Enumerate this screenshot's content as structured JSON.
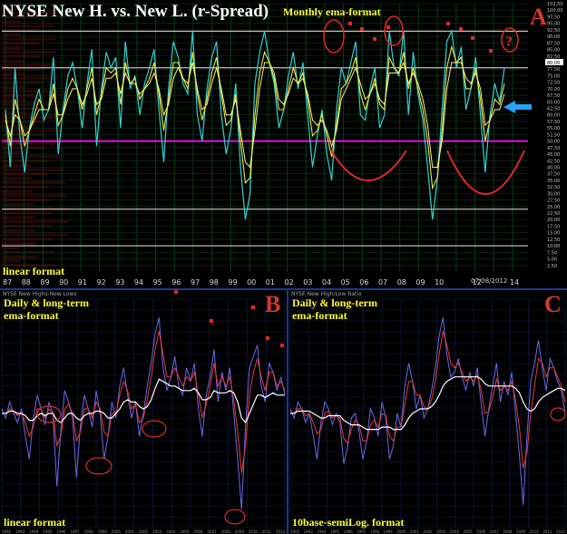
{
  "panel_a": {
    "title": "NYSE New H. vs. New L. (r-Spread)",
    "subtitle": "Monthly ema-format",
    "corner_label": "A",
    "bottom_note": "linear format",
    "date_marker": "07/08/2012",
    "question_mark": "?",
    "last_value_box": "80,00"
  },
  "panel_b": {
    "header_note": "NYSE New Highs-New Lows",
    "label": "Daily & long-term\nema-format",
    "corner_label": "B",
    "bottom_note": "linear format"
  },
  "panel_c": {
    "header_note": "NYSE New High/Low Ratio",
    "label": "Daily & long-term\nema-format",
    "corner_label": "C",
    "bottom_note": "10base-semiLog. format"
  },
  "chart_data": [
    {
      "type": "line",
      "title": "NYSE New H. vs. New L. (r-Spread)",
      "subtitle": "Monthly ema-format",
      "xlabel": "",
      "ylabel": "",
      "x_ticks": [
        "87",
        "88",
        "89",
        "90",
        "91",
        "92",
        "93",
        "94",
        "95",
        "96",
        "97",
        "98",
        "99",
        "00",
        "01",
        "02",
        "03",
        "04",
        "05",
        "06",
        "07",
        "08",
        "09",
        "10",
        "",
        "12",
        "",
        "14"
      ],
      "y_ticks": [
        "102,50",
        "100,00",
        "97,50",
        "95,00",
        "92,50",
        "90,00",
        "87,50",
        "85,00",
        "82,50",
        "80,00",
        "77,50",
        "75,00",
        "72,50",
        "70,00",
        "67,50",
        "65,00",
        "62,50",
        "60,00",
        "57,50",
        "55,00",
        "52,50",
        "50,00",
        "47,50",
        "45,00",
        "42,50",
        "40,00",
        "37,50",
        "35,00",
        "32,50",
        "30,00",
        "27,50",
        "25,00",
        "22,50",
        "20,00",
        "17,50",
        "15,00",
        "12,50",
        "10,00",
        "7,50",
        "5,00",
        "2,50"
      ],
      "ylim": [
        0,
        102.5
      ],
      "reference_lines": [
        92,
        78,
        50,
        24,
        10
      ],
      "highlight_line": 50,
      "series": [
        {
          "values": [
            62,
            40,
            78,
            52,
            38,
            55,
            64,
            70,
            58,
            62,
            82,
            45,
            62,
            75,
            80,
            70,
            55,
            72,
            85,
            48,
            70,
            84,
            78,
            82,
            55,
            88,
            70,
            75,
            60,
            72,
            78,
            85,
            62,
            42,
            70,
            88,
            82,
            72,
            68,
            92,
            60,
            50,
            70,
            82,
            88,
            60,
            45,
            55,
            72,
            40,
            20,
            30,
            72,
            84,
            92,
            80,
            72,
            55,
            62,
            75,
            84,
            70,
            80,
            60,
            40,
            52,
            62,
            45,
            35,
            62,
            78,
            72,
            80,
            88,
            60,
            58,
            70,
            78,
            55,
            60,
            92,
            78,
            75,
            92,
            60,
            84,
            68,
            58,
            40,
            20,
            35,
            62,
            88,
            92,
            78,
            86,
            62,
            70,
            82,
            60,
            38,
            60,
            72,
            65,
            78
          ]
        },
        {
          "values": [
            60,
            48,
            66,
            58,
            48,
            54,
            60,
            66,
            62,
            62,
            72,
            56,
            60,
            70,
            74,
            70,
            62,
            70,
            78,
            60,
            68,
            78,
            76,
            78,
            64,
            80,
            72,
            74,
            66,
            70,
            74,
            80,
            68,
            54,
            66,
            80,
            80,
            74,
            70,
            84,
            68,
            58,
            66,
            76,
            82,
            68,
            56,
            58,
            68,
            50,
            34,
            36,
            60,
            76,
            84,
            80,
            74,
            62,
            62,
            70,
            78,
            72,
            76,
            66,
            52,
            54,
            60,
            52,
            44,
            56,
            70,
            72,
            76,
            82,
            68,
            62,
            68,
            74,
            64,
            62,
            82,
            78,
            76,
            84,
            70,
            78,
            70,
            62,
            50,
            32,
            36,
            54,
            78,
            86,
            80,
            82,
            70,
            70,
            78,
            66,
            50,
            58,
            66,
            64,
            72
          ]
        },
        {
          "values": [
            58,
            52,
            60,
            58,
            52,
            54,
            58,
            62,
            62,
            62,
            68,
            60,
            60,
            66,
            70,
            70,
            64,
            68,
            74,
            64,
            66,
            74,
            74,
            76,
            68,
            76,
            72,
            72,
            68,
            70,
            72,
            76,
            70,
            60,
            64,
            74,
            78,
            74,
            72,
            80,
            70,
            62,
            64,
            72,
            78,
            70,
            60,
            60,
            66,
            54,
            42,
            40,
            54,
            70,
            80,
            80,
            76,
            66,
            64,
            68,
            74,
            72,
            74,
            68,
            58,
            56,
            58,
            54,
            48,
            54,
            66,
            70,
            74,
            78,
            72,
            66,
            68,
            72,
            66,
            64,
            76,
            76,
            76,
            80,
            72,
            76,
            72,
            66,
            56,
            40,
            40,
            50,
            70,
            80,
            80,
            80,
            74,
            72,
            76,
            70,
            56,
            58,
            62,
            62,
            68
          ]
        }
      ]
    },
    {
      "type": "line",
      "title": "Daily & long-term ema-format",
      "xlabel": "",
      "ylabel": "",
      "x_ticks": [
        "1992",
        "1993",
        "1994",
        "1995",
        "1996",
        "1997",
        "1998",
        "1999",
        "2000",
        "2001",
        "2002",
        "2003",
        "2004",
        "2005",
        "2006",
        "2007",
        "2008",
        "2009",
        "2010",
        "2011",
        "2012"
      ],
      "series": [
        {
          "values": [
            52,
            48,
            55,
            50,
            46,
            52,
            40,
            30,
            48,
            58,
            52,
            45,
            55,
            50,
            18,
            42,
            60,
            55,
            48,
            22,
            45,
            58,
            52,
            44,
            60,
            50,
            30,
            40,
            55,
            48,
            62,
            70,
            58,
            48,
            55,
            40,
            50,
            62,
            72,
            85,
            92,
            70,
            60,
            66,
            75,
            62,
            58,
            70,
            64,
            72,
            52,
            40,
            58,
            66,
            78,
            55,
            68,
            60,
            70,
            50,
            30,
            8,
            45,
            70,
            75,
            80,
            62,
            55,
            72,
            68,
            60,
            66,
            58
          ]
        },
        {
          "values": [
            50,
            50,
            52,
            51,
            49,
            50,
            46,
            40,
            44,
            52,
            52,
            48,
            52,
            50,
            36,
            40,
            52,
            54,
            50,
            38,
            42,
            52,
            52,
            48,
            55,
            52,
            42,
            40,
            50,
            50,
            58,
            64,
            60,
            52,
            54,
            46,
            48,
            56,
            66,
            78,
            86,
            76,
            66,
            66,
            70,
            66,
            62,
            66,
            64,
            68,
            58,
            48,
            54,
            62,
            72,
            62,
            66,
            62,
            66,
            56,
            42,
            24,
            36,
            58,
            68,
            74,
            66,
            60,
            68,
            68,
            62,
            64,
            60
          ]
        },
        {
          "values": [
            50,
            50,
            51,
            51,
            50,
            50,
            49,
            47,
            47,
            49,
            50,
            49,
            50,
            50,
            47,
            46,
            48,
            50,
            50,
            48,
            47,
            49,
            50,
            50,
            51,
            51,
            50,
            48,
            48,
            50,
            52,
            55,
            56,
            55,
            55,
            53,
            52,
            53,
            56,
            61,
            65,
            64,
            63,
            62,
            62,
            61,
            60,
            60,
            60,
            61,
            59,
            56,
            56,
            57,
            60,
            59,
            59,
            59,
            60,
            59,
            55,
            48,
            46,
            50,
            54,
            58,
            58,
            57,
            58,
            59,
            58,
            58,
            58
          ]
        }
      ]
    },
    {
      "type": "line",
      "title": "Daily & long-term ema-format",
      "xlabel": "",
      "ylabel": "",
      "x_ticks": [
        "1992",
        "1993",
        "1994",
        "1995",
        "1996",
        "1997",
        "1998",
        "1999",
        "2000",
        "2001",
        "2002",
        "2003",
        "2004",
        "2005",
        "2006",
        "2007",
        "2008",
        "2009",
        "2010",
        "2011",
        "2012"
      ],
      "series": [
        {
          "values": [
            52,
            48,
            55,
            52,
            46,
            50,
            40,
            30,
            46,
            55,
            52,
            45,
            50,
            46,
            28,
            35,
            48,
            50,
            42,
            30,
            38,
            52,
            48,
            40,
            55,
            48,
            30,
            36,
            50,
            44,
            62,
            72,
            64,
            52,
            58,
            48,
            52,
            60,
            70,
            84,
            92,
            76,
            66,
            68,
            74,
            66,
            60,
            68,
            62,
            70,
            54,
            40,
            52,
            62,
            72,
            55,
            64,
            58,
            68,
            50,
            32,
            10,
            40,
            64,
            72,
            82,
            70,
            60,
            74,
            70,
            64,
            60,
            50
          ]
        },
        {
          "values": [
            51,
            50,
            52,
            52,
            49,
            50,
            46,
            41,
            43,
            50,
            51,
            48,
            49,
            48,
            39,
            37,
            43,
            47,
            45,
            38,
            38,
            45,
            47,
            44,
            50,
            49,
            40,
            38,
            44,
            44,
            54,
            64,
            64,
            58,
            58,
            53,
            52,
            56,
            64,
            76,
            86,
            80,
            72,
            70,
            72,
            68,
            64,
            66,
            64,
            67,
            60,
            50,
            51,
            57,
            65,
            60,
            62,
            60,
            64,
            56,
            44,
            26,
            33,
            50,
            62,
            74,
            72,
            66,
            70,
            70,
            66,
            62,
            55
          ]
        },
        {
          "values": [
            50,
            50,
            51,
            51,
            51,
            51,
            50,
            49,
            48,
            48,
            49,
            49,
            49,
            49,
            47,
            46,
            45,
            45,
            45,
            44,
            43,
            43,
            43,
            43,
            44,
            44,
            44,
            43,
            43,
            43,
            45,
            48,
            50,
            51,
            52,
            52,
            52,
            53,
            55,
            58,
            62,
            64,
            65,
            66,
            66,
            66,
            66,
            66,
            66,
            66,
            65,
            63,
            62,
            62,
            62,
            62,
            62,
            62,
            62,
            61,
            59,
            55,
            52,
            51,
            52,
            55,
            57,
            58,
            59,
            60,
            61,
            61,
            60
          ]
        }
      ]
    }
  ]
}
